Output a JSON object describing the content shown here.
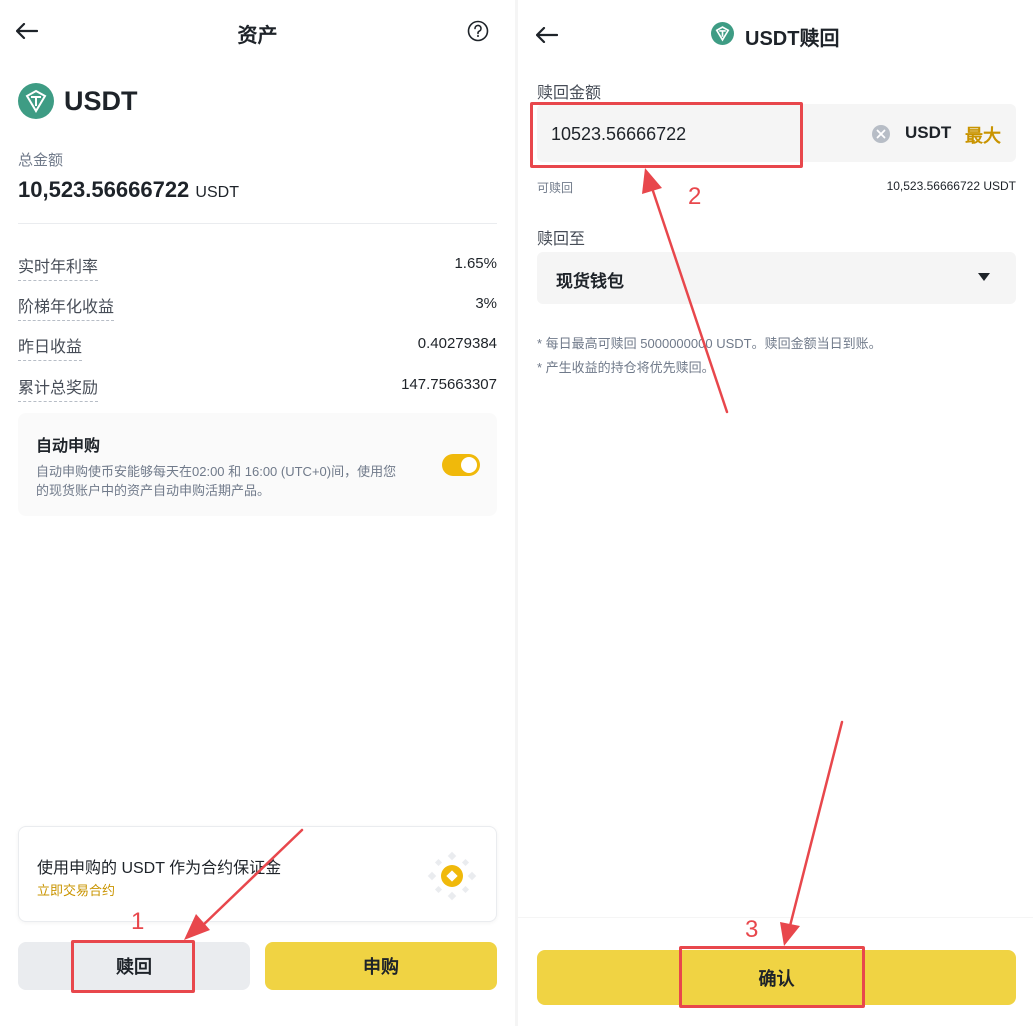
{
  "left": {
    "title": "资产",
    "coin": "USDT",
    "total_label": "总金额",
    "total_value": "10,523.56666722",
    "total_unit": "USDT",
    "rows": [
      {
        "label": "实时年利率",
        "value": "1.65%"
      },
      {
        "label": "阶梯年化收益",
        "value": "3%"
      },
      {
        "label": "昨日收益",
        "value": "0.40279384"
      },
      {
        "label": "累计总奖励",
        "value": "147.75663307"
      }
    ],
    "auto": {
      "title": "自动申购",
      "desc1": "自动申购使币安能够每天在02:00 和 16:00 (UTC+0)间，使用您",
      "desc2": "的现货账户中的资产自动申购活期产品。",
      "enabled": true
    },
    "promo": {
      "text": "使用申购的 USDT 作为合约保证金",
      "link": "立即交易合约"
    },
    "redeem_button": "赎回",
    "subscribe_button": "申购"
  },
  "right": {
    "title": "USDT赎回",
    "amount_label": "赎回金额",
    "amount_value": "10523.56666722",
    "amount_unit": "USDT",
    "max_label": "最大",
    "available_label": "可赎回",
    "available_value": "10,523.56666722 USDT",
    "to_label": "赎回至",
    "to_value": "现货钱包",
    "note1": "* 每日最高可赎回 5000000000 USDT。赎回金额当日到账。",
    "note2": "* 产生收益的持仓将优先赎回。",
    "confirm_button": "确认"
  },
  "annotations": [
    "1",
    "2",
    "3"
  ],
  "colors": {
    "brand_yellow": "#f0d343",
    "toggle_yellow": "#f0b90b",
    "max_gold": "#c99400",
    "annotation_red": "#e8474c",
    "usdt_green": "#3e9c84"
  }
}
